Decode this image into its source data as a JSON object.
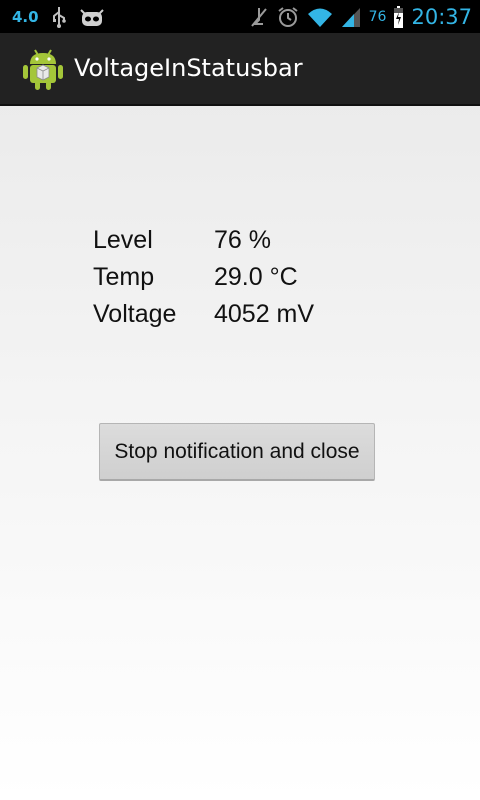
{
  "status_bar": {
    "android_version": "4.0",
    "battery_percent": "76",
    "time": "20:37",
    "icons": [
      "usb-icon",
      "cyanogen-bugdroid-icon",
      "mute-icon",
      "alarm-icon",
      "wifi-icon",
      "signal-icon",
      "battery-charging-icon"
    ],
    "accent_color": "#33b5e5"
  },
  "action_bar": {
    "app_icon": "android-robot-icon",
    "title": "VoltageInStatusbar"
  },
  "stats": [
    {
      "label": "Level",
      "value": "76 %"
    },
    {
      "label": "Temp",
      "value": "29.0 °C"
    },
    {
      "label": "Voltage",
      "value": "4052 mV"
    }
  ],
  "button": {
    "label": "Stop notification and close"
  }
}
